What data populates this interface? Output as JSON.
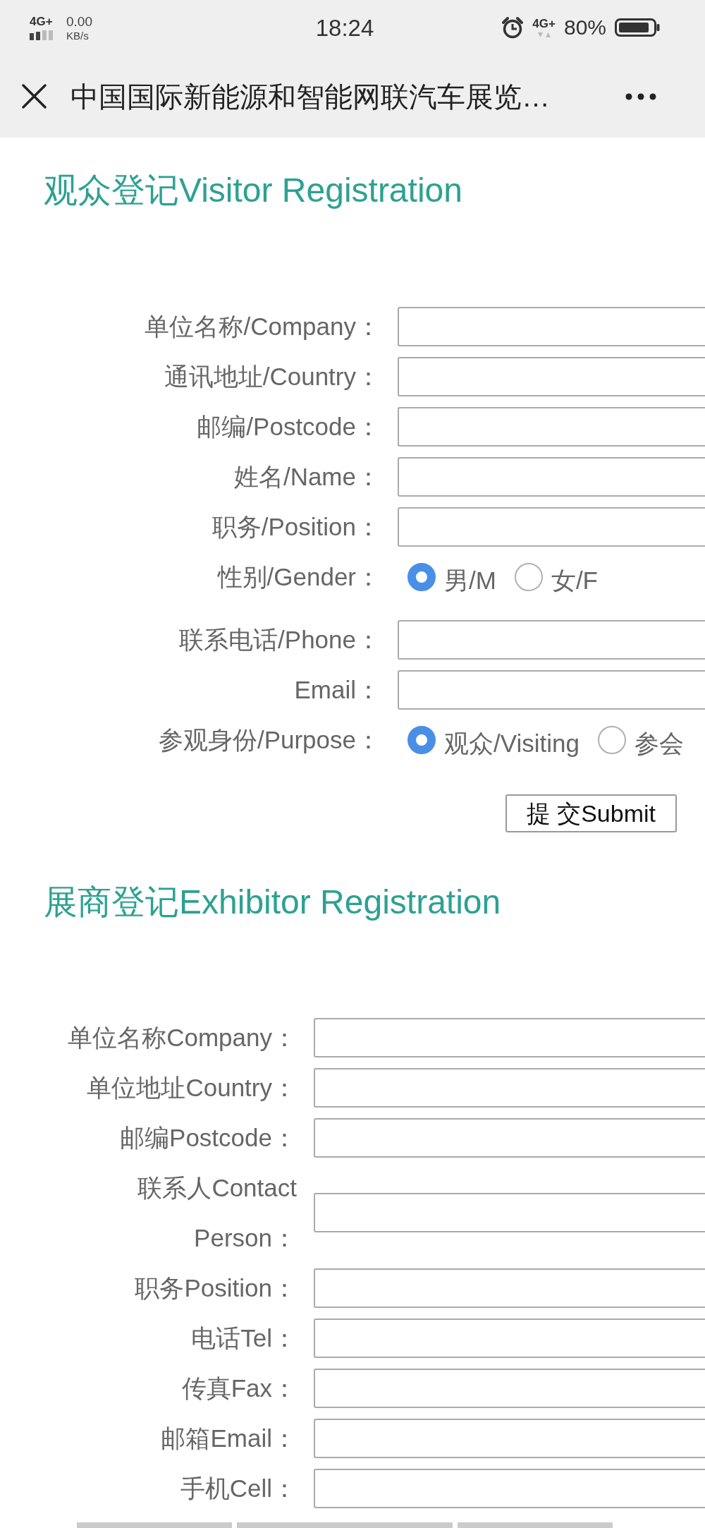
{
  "status_bar": {
    "network_left": "4G+",
    "speed": "0.00",
    "speed_unit": "KB/s",
    "time": "18:24",
    "network_right": "4G+",
    "battery": "80%"
  },
  "title_bar": {
    "title": "中国国际新能源和智能网联汽车展览…"
  },
  "visitor_form": {
    "heading": "观众登记Visitor Registration",
    "fields": [
      {
        "kind": "text",
        "label": "单位名称/Company："
      },
      {
        "kind": "text",
        "label": "通讯地址/Country："
      },
      {
        "kind": "text",
        "label": "邮编/Postcode："
      },
      {
        "kind": "text",
        "label": "姓名/Name："
      },
      {
        "kind": "text",
        "label": "职务/Position："
      },
      {
        "kind": "radio",
        "label": "性别/Gender：",
        "options": [
          {
            "label": "男/M",
            "selected": true
          },
          {
            "label": "女/F",
            "selected": false
          }
        ]
      },
      {
        "kind": "text",
        "label": "联系电话/Phone："
      },
      {
        "kind": "text",
        "label": "Email："
      },
      {
        "kind": "radio",
        "label": "参观身份/Purpose：",
        "options": [
          {
            "label": "观众/Visiting",
            "selected": true
          },
          {
            "label": "参会",
            "selected": false
          }
        ]
      }
    ],
    "submit": "提 交Submit"
  },
  "exhibitor_form": {
    "heading": "展商登记Exhibitor Registration",
    "fields": [
      {
        "kind": "text",
        "label": "单位名称Company："
      },
      {
        "kind": "text",
        "label": "单位地址Country："
      },
      {
        "kind": "text",
        "label": "邮编Postcode："
      },
      {
        "kind": "text",
        "label": "联系人Contact Person："
      },
      {
        "kind": "text",
        "label": "职务Position："
      },
      {
        "kind": "text",
        "label": "电话Tel："
      },
      {
        "kind": "text",
        "label": "传真Fax："
      },
      {
        "kind": "text",
        "label": "邮箱Email："
      },
      {
        "kind": "text",
        "label": "手机Cell："
      }
    ]
  }
}
